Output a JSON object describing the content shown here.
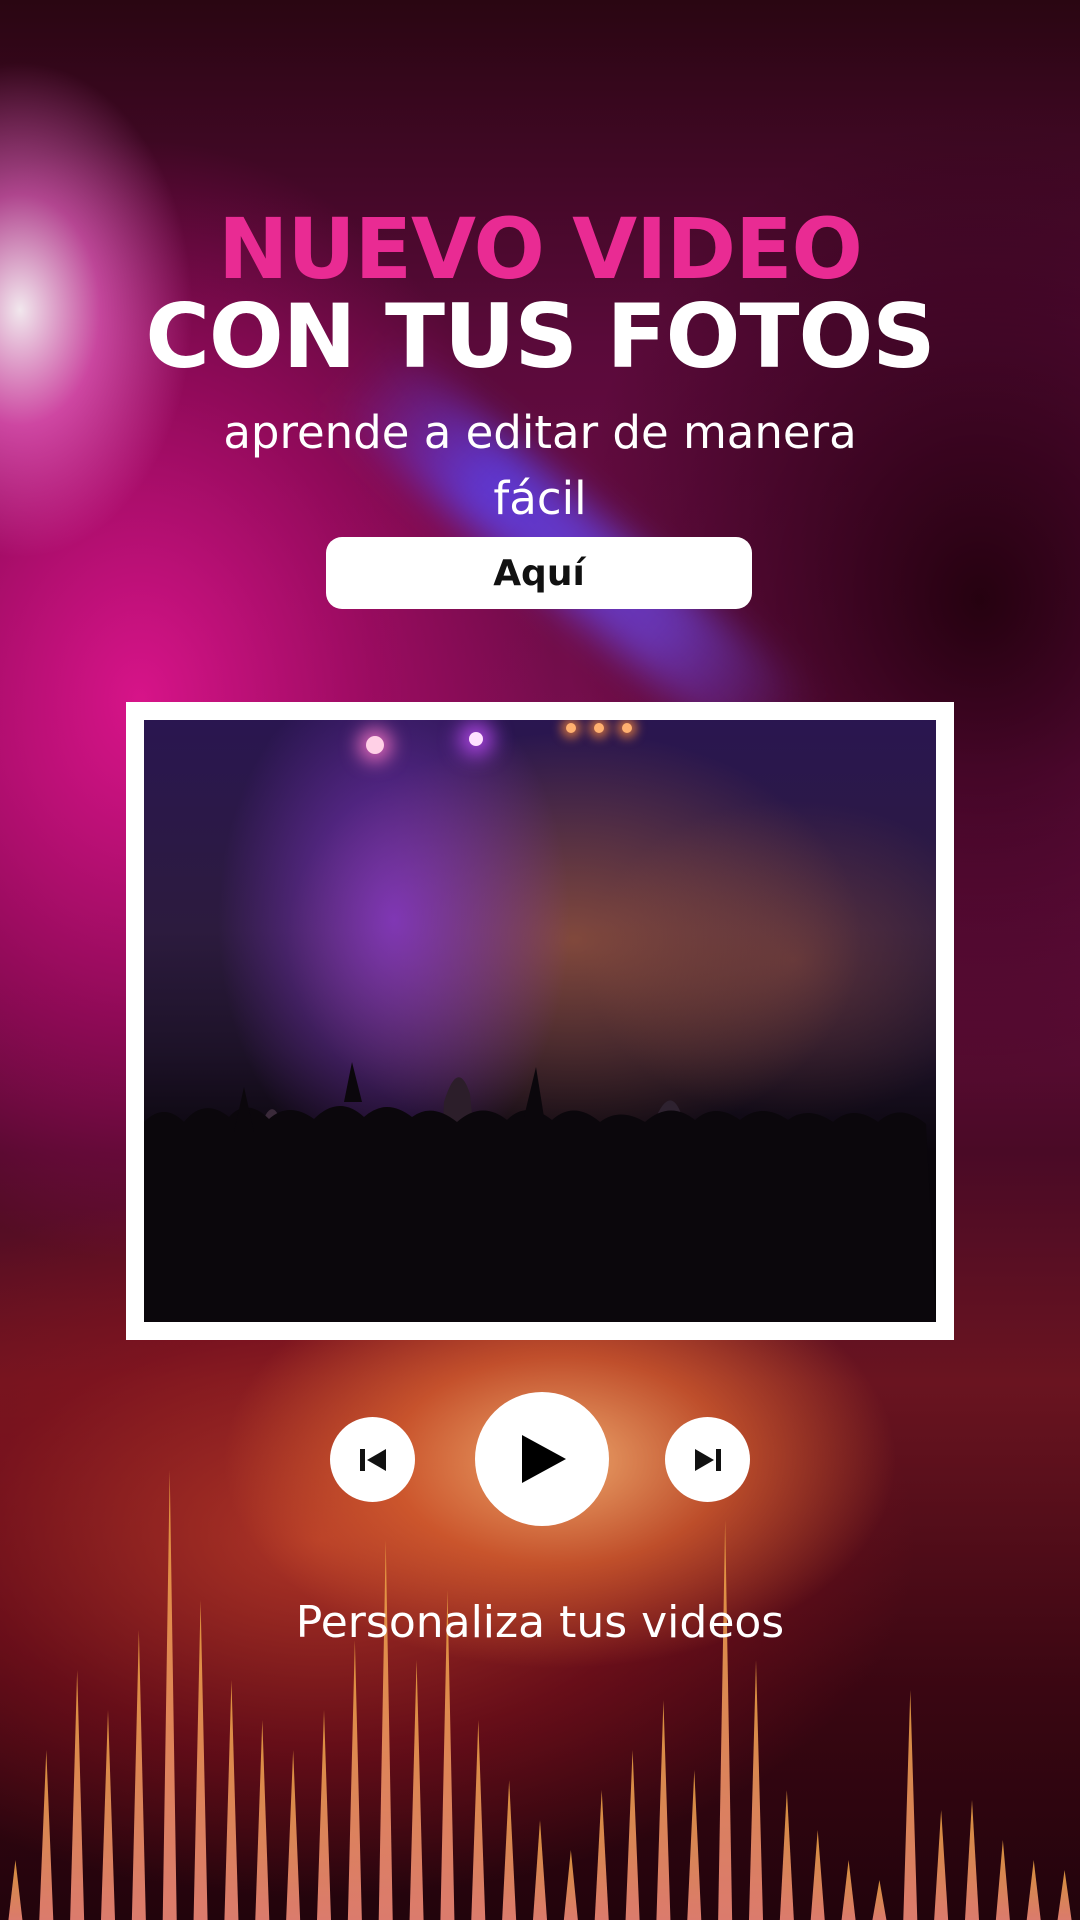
{
  "headline": {
    "line1": "NUEVO VIDEO",
    "line2": "CON TUS FOTOS"
  },
  "subtitle": "aprende a editar de manera fácil",
  "cta": {
    "label": "Aquí"
  },
  "player": {
    "icons": [
      "skip-previous-icon",
      "play-icon",
      "skip-next-icon"
    ]
  },
  "caption": "Personaliza tus videos",
  "colors": {
    "accent_pink": "#e92b93",
    "text_white": "#ffffff",
    "button_bg": "#ffffff",
    "spike_color": "#f0966e"
  }
}
